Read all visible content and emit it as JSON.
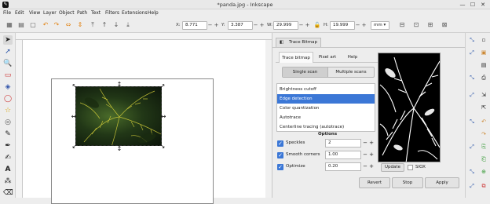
{
  "window": {
    "title": "*panda.jpg - Inkscape",
    "app_icon": "inkscape-icon",
    "minimize": "—",
    "maximize": "☐",
    "close": "✕"
  },
  "menu": [
    "File",
    "Edit",
    "View",
    "Layer",
    "Object",
    "Path",
    "Text",
    "Filters",
    "Extensions",
    "Help"
  ],
  "toolbar": {
    "x_label": "X:",
    "x_value": "8.771",
    "y_label": "Y:",
    "y_value": "3.387",
    "w_label": "W:",
    "w_value": "29.999",
    "h_label": "H:",
    "h_value": "19.999",
    "unit": "mm",
    "minus": "−",
    "plus": "+"
  },
  "dialog": {
    "panel_tab": "Trace Bitmap",
    "tabs": [
      "Trace bitmap",
      "Pixel art",
      "Help"
    ],
    "scan_tabs": [
      "Single scan",
      "Multiple scans"
    ],
    "modes": [
      "Brightness cutoff",
      "Edge detection",
      "Color quantization",
      "Autotrace",
      "Centerline tracing (autotrace)"
    ],
    "selected_mode_index": 1,
    "options_label": "Options",
    "options": [
      {
        "name": "Speckles",
        "value": "2"
      },
      {
        "name": "Smooth corners",
        "value": "1.00"
      },
      {
        "name": "Optimize",
        "value": "0.20"
      }
    ],
    "update_label": "Update",
    "siox_label": "SIOX",
    "revert_label": "Revert",
    "stop_label": "Stop",
    "apply_label": "Apply"
  },
  "colors": {
    "accent": "#3b77d6",
    "leaf_dark": "#0c150a",
    "leaf_mid": "#4a6b2a",
    "vein": "#d8d23a"
  }
}
